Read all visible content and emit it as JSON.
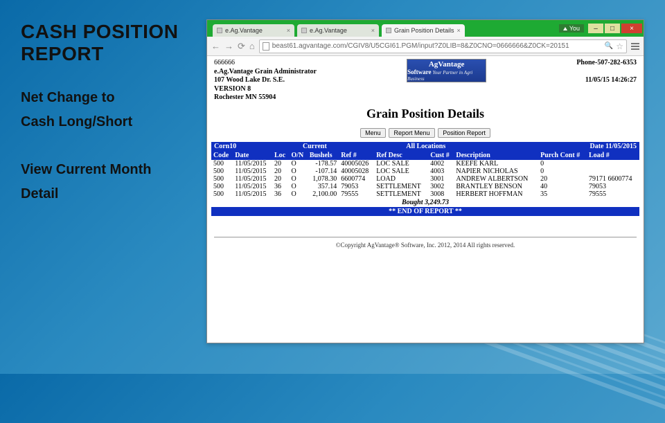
{
  "slide": {
    "title_line1": "CASH POSITION",
    "title_line2": "REPORT",
    "bullets": [
      "Net Change to",
      "Cash Long/Short",
      "View Current Month",
      "Detail"
    ]
  },
  "window": {
    "you_label": "You",
    "tabs": [
      {
        "label": "e.Ag.Vantage",
        "active": false
      },
      {
        "label": "e.Ag.Vantage",
        "active": false
      },
      {
        "label": "Grain Position Details",
        "active": true
      }
    ],
    "url": "beast61.agvantage.com/CGIV8/U5CGI61.PGM/input?Z0LIB=8&Z0CNO=0666666&Z0CK=20151"
  },
  "page": {
    "company": {
      "number": "666666",
      "name": "e.Ag.Vantage Grain Administrator",
      "addr1": "107 Wood Lake Dr. S.E.",
      "version": "VERSION 8",
      "city": "Rochester MN 55904"
    },
    "logo": {
      "line1": "AgVantage",
      "line2": "Software",
      "tag": "Your Partner in Agri Business"
    },
    "phone": "Phone-507-282-6353",
    "timestamp": "11/05/15 14:26:27",
    "title": "Grain Position Details",
    "buttons": [
      "Menu",
      "Report Menu",
      "Position Report"
    ],
    "header_bar": {
      "left": "Corn10",
      "center": "Current",
      "all": "All Locations",
      "right": "Date 11/05/2015"
    },
    "columns": [
      "Code",
      "Date",
      "Loc",
      "O/N",
      "Bushels",
      "Ref #",
      "Ref Desc",
      "Cust #",
      "Description",
      "Purch Cont #",
      "Load #"
    ],
    "rows": [
      [
        "500",
        "11/05/2015",
        "20",
        "O",
        "-178.57",
        "40005026",
        "LOC SALE",
        "4002",
        "KEEFE KARL",
        "0",
        ""
      ],
      [
        "500",
        "11/05/2015",
        "20",
        "O",
        "-107.14",
        "40005028",
        "LOC SALE",
        "4003",
        "NAPIER NICHOLAS",
        "0",
        ""
      ],
      [
        "500",
        "11/05/2015",
        "20",
        "O",
        "1,078.30",
        "6600774",
        "LOAD",
        "3001",
        "ANDREW ALBERTSON",
        "20",
        "79171 6600774"
      ],
      [
        "500",
        "11/05/2015",
        "36",
        "O",
        "357.14",
        "79053",
        "SETTLEMENT",
        "3002",
        "BRANTLEY BENSON",
        "40",
        "79053"
      ],
      [
        "500",
        "11/05/2015",
        "36",
        "O",
        "2,100.00",
        "79555",
        "SETTLEMENT",
        "3008",
        "HERBERT HOFFMAN",
        "35",
        "79555"
      ]
    ],
    "total_label": "Bought 3,249.73",
    "end_label": "** END OF REPORT **",
    "copyright": "©Copyright AgVantage® Software, Inc. 2012, 2014 All rights reserved."
  }
}
